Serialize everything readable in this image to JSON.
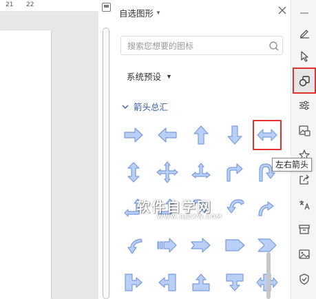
{
  "ruler": {
    "marks": [
      "21",
      "22"
    ]
  },
  "panel": {
    "title": "自选图形",
    "search": {
      "placeholder": "搜索您想要的图标",
      "value": ""
    },
    "preset": {
      "label": "系统预设"
    },
    "category": {
      "label": "箭头总汇"
    },
    "shapes": [
      {
        "name": "right-arrow",
        "icon": "arrow-right"
      },
      {
        "name": "left-arrow",
        "icon": "arrow-left"
      },
      {
        "name": "up-arrow",
        "icon": "arrow-up"
      },
      {
        "name": "down-arrow",
        "icon": "arrow-down"
      },
      {
        "name": "left-right-arrow",
        "icon": "arrow-left-right",
        "highlighted": true
      },
      {
        "name": "up-down-arrow",
        "icon": "arrow-up-down"
      },
      {
        "name": "quad-arrow",
        "icon": "arrow-quad"
      },
      {
        "name": "left-right-up-arrow",
        "icon": "arrow-left-right-up"
      },
      {
        "name": "bent-arrow",
        "icon": "arrow-bent"
      },
      {
        "name": "u-turn-arrow",
        "icon": "arrow-u-turn"
      },
      {
        "name": "left-up-arrow",
        "icon": "arrow-left-up"
      },
      {
        "name": "bent-up-arrow",
        "icon": "arrow-bent-up"
      },
      {
        "name": "curved-right-arrow",
        "icon": "arrow-curved-right"
      },
      {
        "name": "curved-left-arrow",
        "icon": "arrow-curved-left"
      },
      {
        "name": "curved-up-arrow",
        "icon": "arrow-curved-up"
      },
      {
        "name": "curved-down-arrow",
        "icon": "arrow-curved-down"
      },
      {
        "name": "striped-right-arrow",
        "icon": "arrow-striped-right"
      },
      {
        "name": "notched-right-arrow",
        "icon": "arrow-notched-right"
      },
      {
        "name": "pentagon-arrow",
        "icon": "pentagon"
      },
      {
        "name": "chevron-arrow",
        "icon": "chevron"
      },
      {
        "name": "right-arrow-callout",
        "icon": "callout-right"
      },
      {
        "name": "left-arrow-callout",
        "icon": "callout-left"
      },
      {
        "name": "up-arrow-callout",
        "icon": "callout-up"
      },
      {
        "name": "down-arrow-callout",
        "icon": "callout-down"
      },
      {
        "name": "left-right-arrow-callout",
        "icon": "callout-left-right"
      }
    ]
  },
  "tooltip": {
    "text": "左右箭头"
  },
  "watermark": {
    "main": "软件自学网",
    "sub": "WWW.RJZXW.COM"
  },
  "right_toolbar": {
    "items": [
      {
        "name": "minimize-bar-icon"
      },
      {
        "name": "pen-icon"
      },
      {
        "name": "cursor-icon"
      },
      {
        "name": "shapes-icon",
        "active": true
      },
      {
        "name": "settings-sliders-icon"
      },
      {
        "name": "picture-icon"
      },
      {
        "name": "star-icon"
      },
      {
        "name": "share-icon"
      },
      {
        "name": "translate-icon"
      },
      {
        "name": "archive-icon"
      },
      {
        "name": "image-icon"
      },
      {
        "name": "shield-icon"
      }
    ]
  },
  "colors": {
    "shape_fill": "#b9cff5",
    "shape_stroke": "#7a9be0",
    "accent_red": "#e03131",
    "category_blue": "#3a5fb0"
  }
}
